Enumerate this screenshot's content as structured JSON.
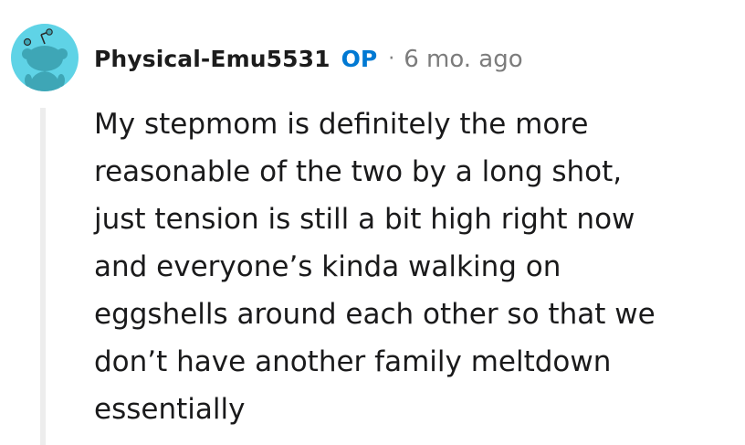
{
  "comment": {
    "author": "Physical-Emu5531",
    "op_badge": "OP",
    "separator": "·",
    "timestamp": "6 mo. ago",
    "avatar_icon": "snoo-avatar-icon",
    "avatar_color": "#5fd3e6",
    "op_color": "#0079d3",
    "lines": [
      "My stepmom is definitely the more",
      "reasonable of the two by a long shot,",
      "just tension is still a bit high right now",
      "and everyone’s kinda walking on",
      "eggshells around each other so that we",
      "don’t have another family meltdown",
      "essentially"
    ]
  }
}
